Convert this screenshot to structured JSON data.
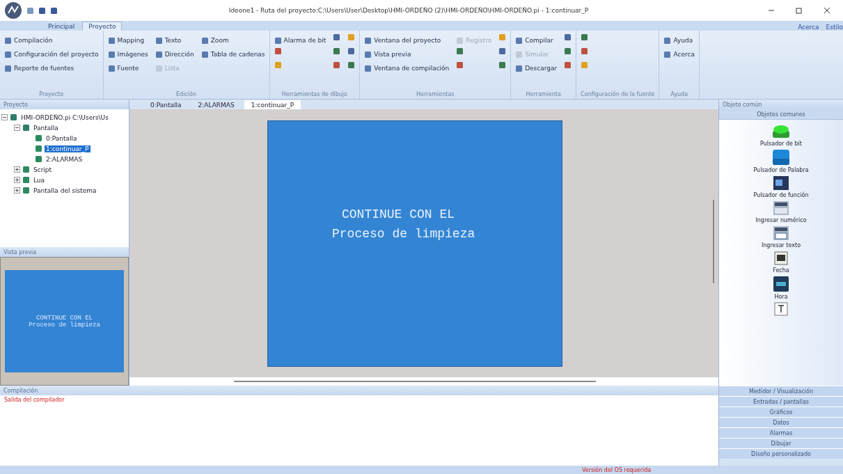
{
  "window": {
    "title": "Ideone1 - Ruta del proyecto:C:\\Users\\User\\Desktop\\HMI-ORDEÑO (2)\\HMI-ORDEÑO\\HMI-ORDEÑO.pi - 1:continuar_P"
  },
  "ribbon_tabs": [
    {
      "label": "Principal",
      "selected": false
    },
    {
      "label": "Proyecto",
      "selected": true
    }
  ],
  "ribbon_links": [
    "Acerca",
    "Estilo"
  ],
  "ribbon_groups": [
    {
      "label": "Proyecto",
      "items": [
        {
          "kind": "label",
          "label": "Compilación",
          "disabled": false
        },
        {
          "kind": "label",
          "label": "Configuración del proyecto",
          "disabled": false
        },
        {
          "kind": "label",
          "label": "Reporte de fuentes",
          "disabled": false
        }
      ]
    },
    {
      "label": "Edición",
      "items": [
        {
          "kind": "label",
          "label": "Mapping",
          "disabled": false
        },
        {
          "kind": "label",
          "label": "Imágenes",
          "disabled": false
        },
        {
          "kind": "label",
          "label": "Fuente",
          "disabled": false
        },
        {
          "kind": "label",
          "label": "Texto",
          "disabled": false
        },
        {
          "kind": "label",
          "label": "Dirección",
          "disabled": false
        },
        {
          "kind": "label",
          "label": "Lista",
          "disabled": true
        },
        {
          "kind": "label",
          "label": "Zoom",
          "disabled": false
        },
        {
          "kind": "label",
          "label": "Tabla de cadenas",
          "disabled": false
        }
      ]
    },
    {
      "label": "Herramientas de dibujo",
      "items": [
        {
          "kind": "label",
          "label": "Alarma de bit",
          "disabled": false
        },
        {
          "kind": "icon"
        },
        {
          "kind": "icon"
        },
        {
          "kind": "icon"
        },
        {
          "kind": "icon"
        },
        {
          "kind": "icon"
        },
        {
          "kind": "icon"
        },
        {
          "kind": "icon"
        },
        {
          "kind": "icon"
        }
      ]
    },
    {
      "label": "Herramientas",
      "items": [
        {
          "kind": "label",
          "label": "Ventana del proyecto",
          "disabled": false
        },
        {
          "kind": "label",
          "label": "Vista previa",
          "disabled": false
        },
        {
          "kind": "label",
          "label": "Ventana de compilación",
          "disabled": false
        },
        {
          "kind": "label",
          "label": "Registro",
          "disabled": true
        },
        {
          "kind": "icon"
        },
        {
          "kind": "icon"
        },
        {
          "kind": "icon"
        },
        {
          "kind": "icon"
        },
        {
          "kind": "icon"
        }
      ]
    },
    {
      "label": "Herramienta",
      "items": [
        {
          "kind": "label",
          "label": "Compilar",
          "disabled": false
        },
        {
          "kind": "label",
          "label": "Simular",
          "disabled": true
        },
        {
          "kind": "label",
          "label": "Descargar",
          "disabled": false
        },
        {
          "kind": "icon"
        },
        {
          "kind": "icon"
        },
        {
          "kind": "icon"
        }
      ]
    },
    {
      "label": "Configuración de la fuente",
      "items": [
        {
          "kind": "icon"
        },
        {
          "kind": "icon"
        },
        {
          "kind": "icon"
        }
      ]
    },
    {
      "label": "Ayuda",
      "items": [
        {
          "kind": "label",
          "label": "Ayuda",
          "disabled": false
        },
        {
          "kind": "label",
          "label": "Acerca",
          "disabled": false
        }
      ]
    }
  ],
  "project_panel": {
    "title": "Proyecto",
    "tree": [
      {
        "label": "HMI-ORDEÑO.pi C:\\Users\\Us",
        "expanded": true,
        "selected": false,
        "children": [
          {
            "label": "Pantalla",
            "expanded": true,
            "selected": false,
            "children": [
              {
                "label": "0:Pantalla",
                "selected": false
              },
              {
                "label": "1:continuar_P",
                "selected": true
              },
              {
                "label": "2:ALARMAS",
                "selected": false
              }
            ]
          },
          {
            "label": "Script",
            "expanded": false,
            "selected": false
          },
          {
            "label": "Lua",
            "expanded": false,
            "selected": false
          },
          {
            "label": "Pantalla del sistema",
            "expanded": false,
            "selected": false
          }
        ]
      }
    ]
  },
  "preview_panel": {
    "title": "Vista previa",
    "lines": [
      "CONTINUE CON EL",
      "Proceso de limpieza"
    ]
  },
  "editor_tabs": [
    {
      "label": "0:Pantalla",
      "selected": false
    },
    {
      "label": "2:ALARMAS",
      "selected": false
    },
    {
      "label": "1:continuar_P",
      "selected": true
    }
  ],
  "screen": {
    "lines": [
      "CONTINUE CON EL",
      "Proceso de limpieza"
    ]
  },
  "objects_panel": {
    "title": "Objeto común",
    "section": "Objetos comunes",
    "items": [
      {
        "kind": "green-button",
        "label": "Pulsador de bit"
      },
      {
        "kind": "blue-button",
        "label": "Pulsador de Palabra"
      },
      {
        "kind": "function",
        "label": "Pulsador de función"
      },
      {
        "kind": "numeric",
        "label": "Ingresar numérico"
      },
      {
        "kind": "text-input",
        "label": "Ingresar texto"
      },
      {
        "kind": "date",
        "label": "Fecha"
      },
      {
        "kind": "time",
        "label": "Hora"
      },
      {
        "kind": "text-tool"
      }
    ],
    "categories": [
      "Medidor / Visualización",
      "Entradas / pantallas",
      "Gráficos",
      "Datos",
      "Alarmas",
      "Dibujar",
      "Diseño personalizado"
    ]
  },
  "compile_panel": {
    "title": "Compilación",
    "message": "Salida del compilador"
  },
  "status_bar": {
    "message": "Versión del OS requerida"
  }
}
